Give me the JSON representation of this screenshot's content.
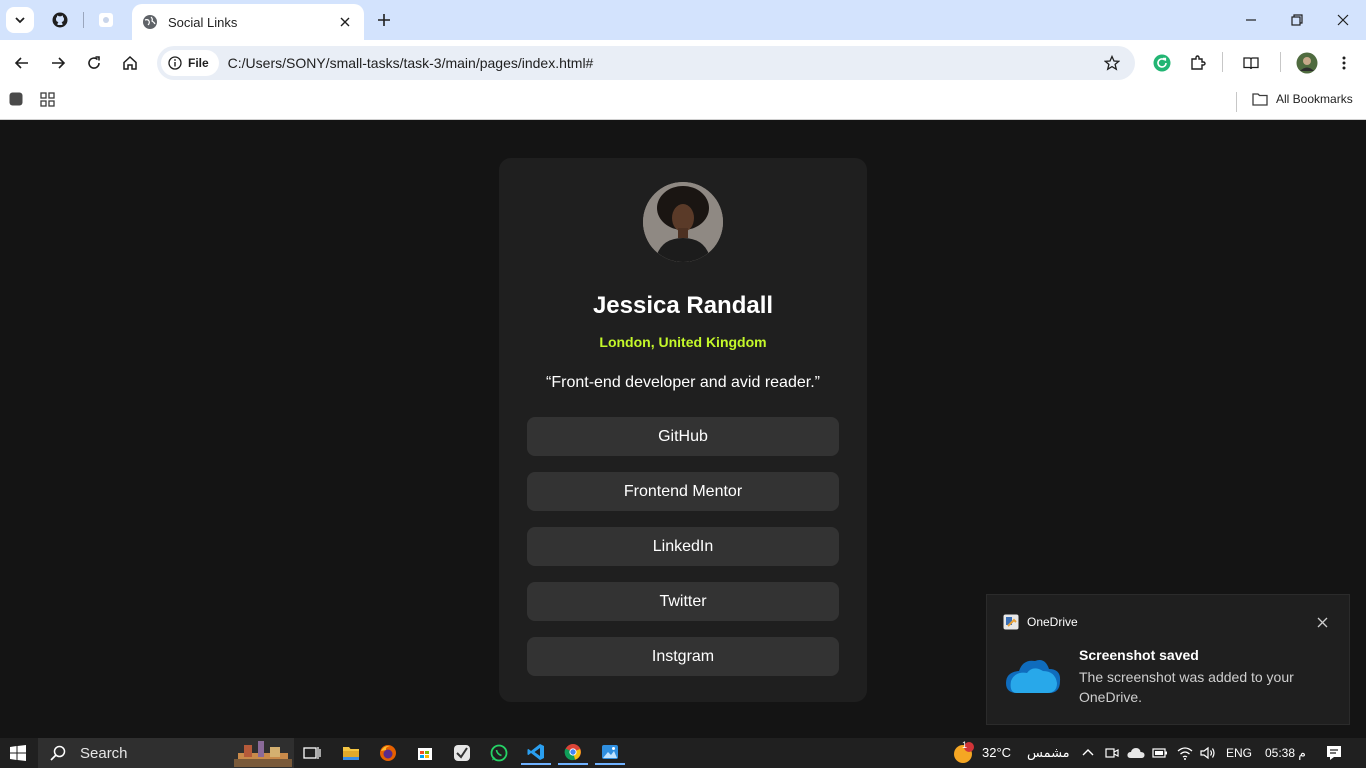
{
  "browser": {
    "active_tab_title": "Social Links",
    "address_chip": "File",
    "url": "C:/Users/SONY/small-tasks/task-3/main/pages/index.html#",
    "bookmarks_label": "All Bookmarks"
  },
  "profile": {
    "name": "Jessica Randall",
    "location": "London, United Kingdom",
    "bio": "“Front-end developer and avid reader.”",
    "links": [
      {
        "label": "GitHub"
      },
      {
        "label": "Frontend Mentor"
      },
      {
        "label": "LinkedIn"
      },
      {
        "label": "Twitter"
      },
      {
        "label": "Instgram"
      }
    ]
  },
  "toast": {
    "app": "OneDrive",
    "title": "Screenshot saved",
    "message": "The screenshot was added to your OneDrive."
  },
  "taskbar": {
    "search_label": "Search",
    "weather_badge": "1",
    "temperature": "32°C",
    "weather_text": "مشمس",
    "language": "ENG",
    "time": "05:38 م"
  },
  "colors": {
    "page_bg": "#141414",
    "card_bg": "#1f1f1f",
    "button_bg": "#333333",
    "accent": "#c4f82a",
    "chrome_tabbar": "#d3e3fd"
  }
}
